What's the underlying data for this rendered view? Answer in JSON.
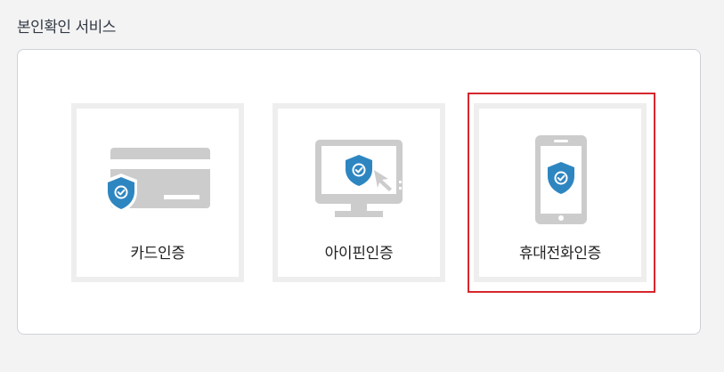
{
  "section": {
    "title": "본인확인 서비스"
  },
  "methods": [
    {
      "id": "card",
      "label": "카드인증",
      "icon": "credit-card-shield-icon",
      "selected": false
    },
    {
      "id": "ipin",
      "label": "아이핀인증",
      "icon": "monitor-shield-icon",
      "selected": false
    },
    {
      "id": "mobile",
      "label": "휴대전화인증",
      "icon": "smartphone-shield-icon",
      "selected": true
    }
  ],
  "colors": {
    "shield": "#2e86c1",
    "icon_gray": "#cccccc",
    "selection_border": "#d6262c",
    "card_border": "#eeeeee"
  }
}
